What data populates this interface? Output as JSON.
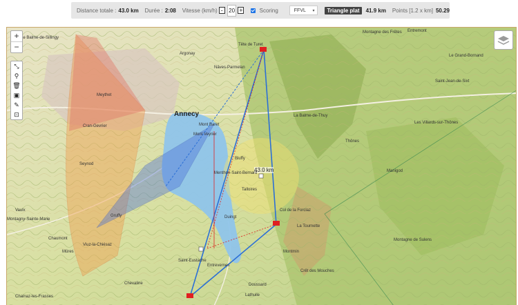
{
  "topbar": {
    "distance_label": "Distance totale :",
    "distance_value": "43.0 km",
    "duration_label": "Durée :",
    "duration_value": "2:08",
    "speed_label": "Vitesse (km/h)",
    "speed_value": "20",
    "speed_decrease": "-",
    "speed_increase": "+",
    "scoring_label": "Scoring",
    "scoring_checked": true,
    "scoring_system": "FFVL",
    "flight_type": "Triangle plat",
    "flight_distance": "41.9 km",
    "points_label": "Points [1.2 x km]",
    "points_value": "50.29"
  },
  "map_controls": {
    "zoom_in": "+",
    "zoom_out": "−",
    "tools": [
      "route-icon",
      "marker-icon",
      "trash-icon",
      "save-icon",
      "ruler-icon",
      "fit-icon"
    ],
    "layers": "layers-icon"
  },
  "map_labels": {
    "town_main": "Annecy",
    "leg_distance": "43.0 km",
    "places": [
      "Le Balme-de-Sillingy",
      "Meythet",
      "Cran-Gevrier",
      "Seynod",
      "Argonay",
      "Nâves-Parmelan",
      "Tête de Turet",
      "Montagne des Frêtes",
      "Entremont",
      "Le Grand-Bornand",
      "Saint-Jean-de-Sixt",
      "Les Villards-sur-Thônes",
      "La Balme-de-Thuy",
      "Thônes",
      "Manigod",
      "Mont Baret",
      "Duingt",
      "Bluffy",
      "Menthon-Saint-Bernard",
      "Talloires",
      "Col de la Forclaz",
      "Montmin",
      "Doussard",
      "Saint-Eustache",
      "Entrevernes",
      "Chaumont",
      "Vaulx",
      "Mûres",
      "Chainaz-les-Frasses",
      "La Tournette",
      "Lathuile",
      "Mont Veyrier",
      "Montagne de Sulens",
      "Crêt des Mouches",
      "Chevaline",
      "Viuz-la-Chiésaz",
      "Gruffy",
      "Montagny-Sainte-Marie"
    ]
  },
  "colors": {
    "route_blue": "#2b6fd6",
    "route_red": "#e02020",
    "sector_red": "#e07a6a",
    "sector_orange": "#f0a050",
    "sector_blue": "#4a6fd8",
    "sector_yellow": "#f2e070",
    "lake": "#8fc4ea"
  }
}
